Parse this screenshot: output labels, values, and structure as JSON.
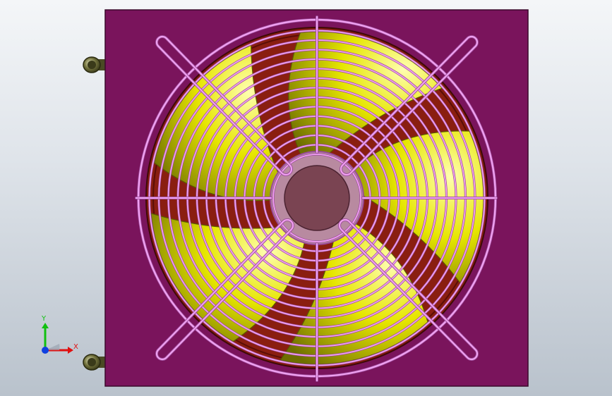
{
  "colors": {
    "panel": "#7a145c",
    "panel_edge": "#3a0a2c",
    "shroud": "#8a1e10",
    "blade": "#e6e600",
    "blade_highlight": "#ffffb0",
    "blade_shadow": "#6e6e00",
    "guard": "#f0a0f0",
    "guard_shadow": "#9a4c9a",
    "hub": "#7a4452",
    "hub_ring": "#b88aa0",
    "pipe": "#6f6f3a",
    "axis_x": "#e01010",
    "axis_y": "#10c010",
    "axis_origin": "#1040e0"
  },
  "icons": {
    "view_triad": "xyz-triad-icon",
    "model": "axial-fan-with-guard"
  },
  "triad": {
    "x_label": "X",
    "y_label": "Y"
  }
}
